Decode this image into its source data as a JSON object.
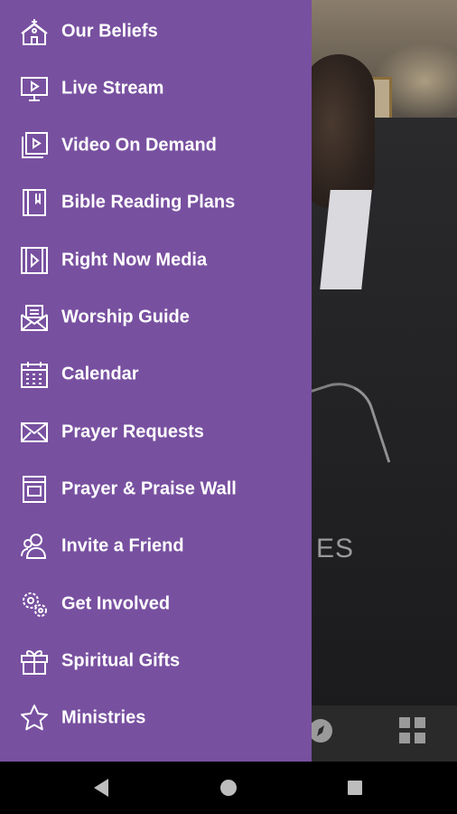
{
  "drawer": {
    "background": "#7850a0",
    "items": [
      {
        "label": "Our Beliefs",
        "icon": "church-icon"
      },
      {
        "label": "Live Stream",
        "icon": "monitor-play-icon"
      },
      {
        "label": "Video On Demand",
        "icon": "video-library-icon"
      },
      {
        "label": "Bible Reading Plans",
        "icon": "bible-icon"
      },
      {
        "label": "Right Now Media",
        "icon": "media-play-icon"
      },
      {
        "label": "Worship Guide",
        "icon": "open-envelope-icon"
      },
      {
        "label": "Calendar",
        "icon": "calendar-icon"
      },
      {
        "label": "Prayer Requests",
        "icon": "envelope-icon"
      },
      {
        "label": "Prayer & Praise Wall",
        "icon": "bulletin-icon"
      },
      {
        "label": "Invite a Friend",
        "icon": "people-icon"
      },
      {
        "label": "Get Involved",
        "icon": "gears-icon"
      },
      {
        "label": "Spiritual Gifts",
        "icon": "gift-icon"
      },
      {
        "label": "Ministries",
        "icon": "star-icon"
      }
    ]
  },
  "background": {
    "partial_text": "ES"
  },
  "tabbar": {
    "icons": [
      "compass-icon",
      "grid-icon"
    ]
  },
  "navbar": {
    "icons": [
      "back-icon",
      "home-icon",
      "recents-icon"
    ]
  }
}
